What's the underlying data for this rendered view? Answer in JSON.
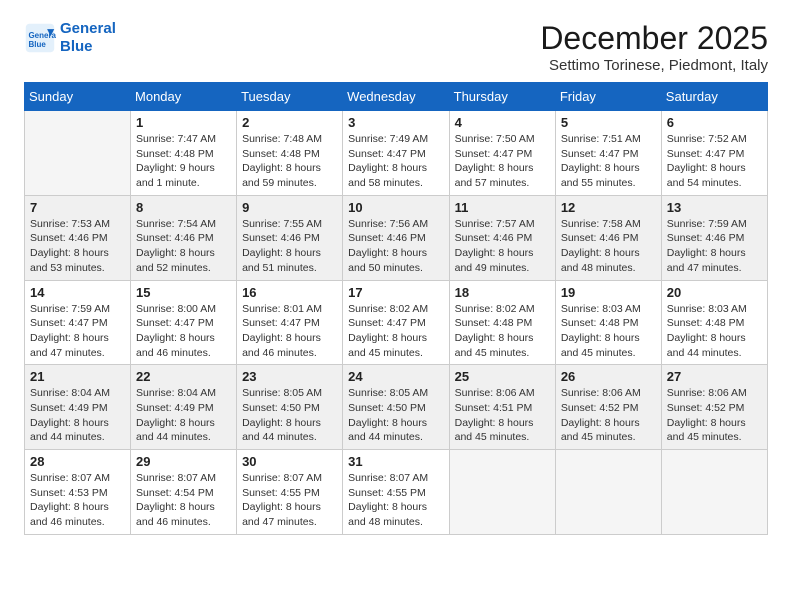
{
  "logo": {
    "line1": "General",
    "line2": "Blue"
  },
  "title": "December 2025",
  "subtitle": "Settimo Torinese, Piedmont, Italy",
  "days_of_week": [
    "Sunday",
    "Monday",
    "Tuesday",
    "Wednesday",
    "Thursday",
    "Friday",
    "Saturday"
  ],
  "weeks": [
    [
      {
        "num": "",
        "info": ""
      },
      {
        "num": "1",
        "info": "Sunrise: 7:47 AM\nSunset: 4:48 PM\nDaylight: 9 hours\nand 1 minute."
      },
      {
        "num": "2",
        "info": "Sunrise: 7:48 AM\nSunset: 4:48 PM\nDaylight: 8 hours\nand 59 minutes."
      },
      {
        "num": "3",
        "info": "Sunrise: 7:49 AM\nSunset: 4:47 PM\nDaylight: 8 hours\nand 58 minutes."
      },
      {
        "num": "4",
        "info": "Sunrise: 7:50 AM\nSunset: 4:47 PM\nDaylight: 8 hours\nand 57 minutes."
      },
      {
        "num": "5",
        "info": "Sunrise: 7:51 AM\nSunset: 4:47 PM\nDaylight: 8 hours\nand 55 minutes."
      },
      {
        "num": "6",
        "info": "Sunrise: 7:52 AM\nSunset: 4:47 PM\nDaylight: 8 hours\nand 54 minutes."
      }
    ],
    [
      {
        "num": "7",
        "info": "Sunrise: 7:53 AM\nSunset: 4:46 PM\nDaylight: 8 hours\nand 53 minutes."
      },
      {
        "num": "8",
        "info": "Sunrise: 7:54 AM\nSunset: 4:46 PM\nDaylight: 8 hours\nand 52 minutes."
      },
      {
        "num": "9",
        "info": "Sunrise: 7:55 AM\nSunset: 4:46 PM\nDaylight: 8 hours\nand 51 minutes."
      },
      {
        "num": "10",
        "info": "Sunrise: 7:56 AM\nSunset: 4:46 PM\nDaylight: 8 hours\nand 50 minutes."
      },
      {
        "num": "11",
        "info": "Sunrise: 7:57 AM\nSunset: 4:46 PM\nDaylight: 8 hours\nand 49 minutes."
      },
      {
        "num": "12",
        "info": "Sunrise: 7:58 AM\nSunset: 4:46 PM\nDaylight: 8 hours\nand 48 minutes."
      },
      {
        "num": "13",
        "info": "Sunrise: 7:59 AM\nSunset: 4:46 PM\nDaylight: 8 hours\nand 47 minutes."
      }
    ],
    [
      {
        "num": "14",
        "info": "Sunrise: 7:59 AM\nSunset: 4:47 PM\nDaylight: 8 hours\nand 47 minutes."
      },
      {
        "num": "15",
        "info": "Sunrise: 8:00 AM\nSunset: 4:47 PM\nDaylight: 8 hours\nand 46 minutes."
      },
      {
        "num": "16",
        "info": "Sunrise: 8:01 AM\nSunset: 4:47 PM\nDaylight: 8 hours\nand 46 minutes."
      },
      {
        "num": "17",
        "info": "Sunrise: 8:02 AM\nSunset: 4:47 PM\nDaylight: 8 hours\nand 45 minutes."
      },
      {
        "num": "18",
        "info": "Sunrise: 8:02 AM\nSunset: 4:48 PM\nDaylight: 8 hours\nand 45 minutes."
      },
      {
        "num": "19",
        "info": "Sunrise: 8:03 AM\nSunset: 4:48 PM\nDaylight: 8 hours\nand 45 minutes."
      },
      {
        "num": "20",
        "info": "Sunrise: 8:03 AM\nSunset: 4:48 PM\nDaylight: 8 hours\nand 44 minutes."
      }
    ],
    [
      {
        "num": "21",
        "info": "Sunrise: 8:04 AM\nSunset: 4:49 PM\nDaylight: 8 hours\nand 44 minutes."
      },
      {
        "num": "22",
        "info": "Sunrise: 8:04 AM\nSunset: 4:49 PM\nDaylight: 8 hours\nand 44 minutes."
      },
      {
        "num": "23",
        "info": "Sunrise: 8:05 AM\nSunset: 4:50 PM\nDaylight: 8 hours\nand 44 minutes."
      },
      {
        "num": "24",
        "info": "Sunrise: 8:05 AM\nSunset: 4:50 PM\nDaylight: 8 hours\nand 44 minutes."
      },
      {
        "num": "25",
        "info": "Sunrise: 8:06 AM\nSunset: 4:51 PM\nDaylight: 8 hours\nand 45 minutes."
      },
      {
        "num": "26",
        "info": "Sunrise: 8:06 AM\nSunset: 4:52 PM\nDaylight: 8 hours\nand 45 minutes."
      },
      {
        "num": "27",
        "info": "Sunrise: 8:06 AM\nSunset: 4:52 PM\nDaylight: 8 hours\nand 45 minutes."
      }
    ],
    [
      {
        "num": "28",
        "info": "Sunrise: 8:07 AM\nSunset: 4:53 PM\nDaylight: 8 hours\nand 46 minutes."
      },
      {
        "num": "29",
        "info": "Sunrise: 8:07 AM\nSunset: 4:54 PM\nDaylight: 8 hours\nand 46 minutes."
      },
      {
        "num": "30",
        "info": "Sunrise: 8:07 AM\nSunset: 4:55 PM\nDaylight: 8 hours\nand 47 minutes."
      },
      {
        "num": "31",
        "info": "Sunrise: 8:07 AM\nSunset: 4:55 PM\nDaylight: 8 hours\nand 48 minutes."
      },
      {
        "num": "",
        "info": ""
      },
      {
        "num": "",
        "info": ""
      },
      {
        "num": "",
        "info": ""
      }
    ]
  ]
}
